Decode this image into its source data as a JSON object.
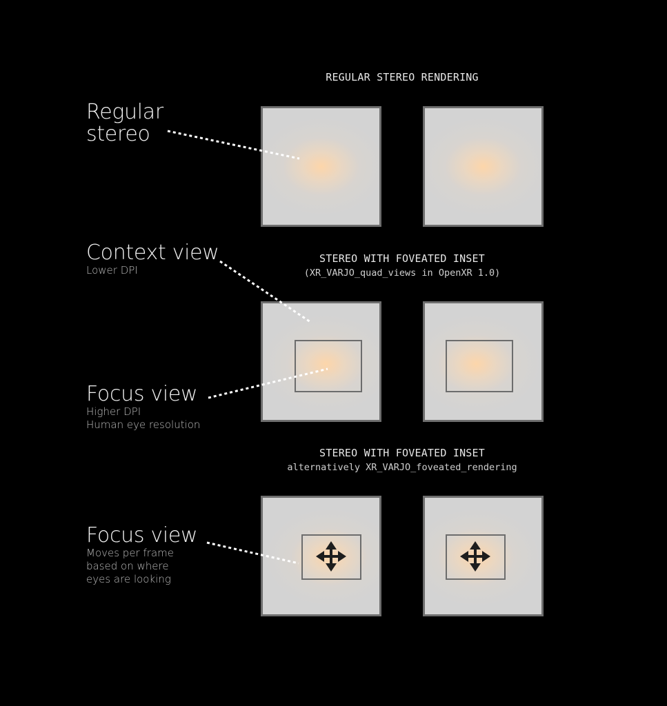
{
  "sections": [
    {
      "title": "REGULAR STEREO RENDERING",
      "subtitle": ""
    },
    {
      "title": "STEREO WITH FOVEATED INSET",
      "subtitle": "(XR_VARJO_quad_views in OpenXR 1.0)"
    },
    {
      "title": "STEREO WITH FOVEATED INSET",
      "subtitle": "alternatively XR_VARJO_foveated_rendering"
    }
  ],
  "labels": {
    "regular_stereo": {
      "lines": [
        "Regular",
        "stereo"
      ]
    },
    "context_view": {
      "title": "Context view",
      "details": [
        "Lower DPI"
      ]
    },
    "focus_view_static": {
      "title": "Focus view",
      "details": [
        "Higher DPI",
        "Human eye resolution"
      ]
    },
    "focus_view_moving": {
      "title": "Focus view",
      "details": [
        "Moves per frame",
        "based on where",
        "eyes are looking"
      ]
    }
  },
  "icons": {
    "inset_marker": "move-arrows-icon"
  },
  "colors": {
    "background": "#000000",
    "eye_fill": "#d3d3d3",
    "eye_border": "#6e6e6e",
    "foveal_glow": "#ffd6a8",
    "leader_line": "#ffffff",
    "icon": "#1e1e1e"
  }
}
